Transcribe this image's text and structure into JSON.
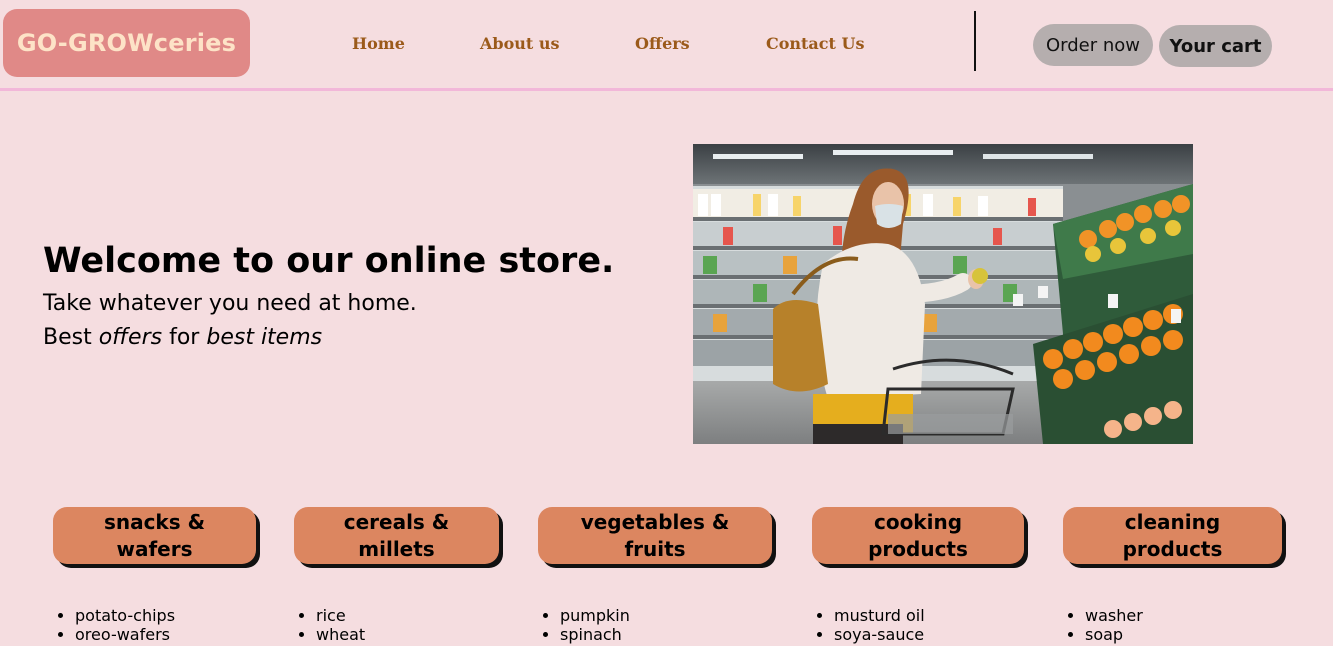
{
  "header": {
    "logo": "GO-GROWceries",
    "nav": [
      "Home",
      "About us",
      "Offers",
      "Contact Us"
    ],
    "order_label": "Order now",
    "cart_label": "Your cart"
  },
  "hero": {
    "title": "Welcome to our online store.",
    "line1": "Take whatever you need at home.",
    "line2_a": "Best ",
    "line2_b": "offers",
    "line2_c": " for ",
    "line2_d": "best items"
  },
  "categories": [
    {
      "line1": "snacks &",
      "line2": "wafers",
      "items": [
        "potato-chips",
        "oreo-wafers"
      ]
    },
    {
      "line1": "cereals &",
      "line2": "millets",
      "items": [
        "rice",
        "wheat"
      ]
    },
    {
      "line1": "vegetables &",
      "line2": "fruits",
      "items": [
        "pumpkin",
        "spinach"
      ]
    },
    {
      "line1": "cooking",
      "line2": "products",
      "items": [
        "musturd oil",
        "soya-sauce"
      ]
    },
    {
      "line1": "cleaning",
      "line2": "products",
      "items": [
        "washer",
        "soap"
      ]
    }
  ],
  "colors": {
    "background": "#f5dde0",
    "logo_bg": "#e08987",
    "logo_text": "#fde3c7",
    "nav_text": "#9b5a1a",
    "header_button": "#b5aeae",
    "category_button": "#dc8660",
    "rule": "#f2b7d9"
  },
  "images": {
    "hero": "woman-shopping-in-supermarket-photo"
  }
}
